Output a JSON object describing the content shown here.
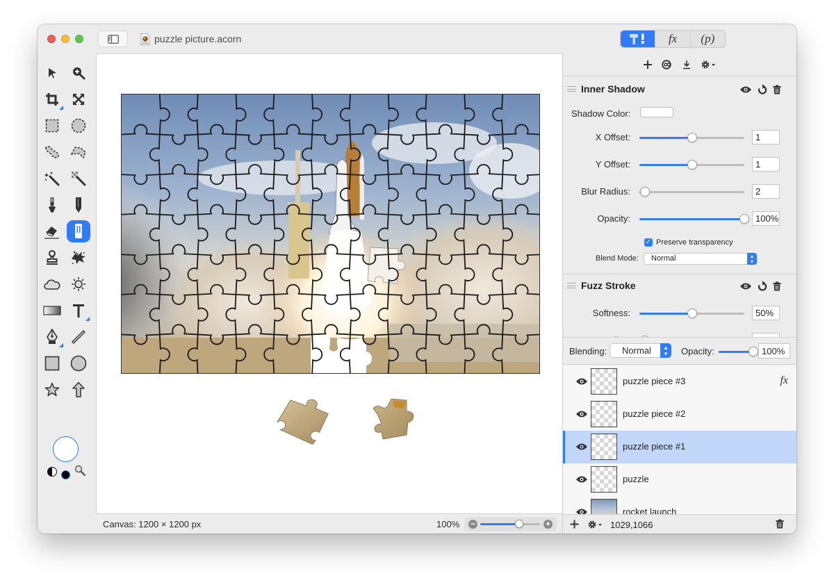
{
  "window": {
    "title": "puzzle picture.acorn",
    "traffic_lights": [
      "close",
      "minimize",
      "zoom"
    ]
  },
  "inspector_tabs": [
    {
      "name": "tools",
      "label": "",
      "icon": "hammer-brush-icon",
      "active": true
    },
    {
      "name": "filters",
      "label": "fx",
      "active": false
    },
    {
      "name": "properties",
      "label": "(p)",
      "active": false
    }
  ],
  "tools": [
    {
      "name": "select-arrow",
      "icon": "arrow-icon"
    },
    {
      "name": "zoom",
      "icon": "magnify-plus-icon"
    },
    {
      "name": "crop",
      "icon": "crop-icon"
    },
    {
      "name": "transform",
      "icon": "expand-arrows-icon"
    },
    {
      "name": "rect-select",
      "icon": "dashed-square-icon"
    },
    {
      "name": "ellipse-select",
      "icon": "dashed-circle-icon"
    },
    {
      "name": "lasso",
      "icon": "lasso-icon"
    },
    {
      "name": "polygon-lasso",
      "icon": "polygon-lasso-icon"
    },
    {
      "name": "magic-wand",
      "icon": "magic-wand-icon"
    },
    {
      "name": "instant-alpha",
      "icon": "instant-alpha-icon"
    },
    {
      "name": "brush",
      "icon": "brush-icon"
    },
    {
      "name": "pencil",
      "icon": "pencil-icon"
    },
    {
      "name": "eraser",
      "icon": "eraser-icon"
    },
    {
      "name": "clone",
      "icon": "clone-tool-icon",
      "active": true
    },
    {
      "name": "stamp",
      "icon": "stamp-icon"
    },
    {
      "name": "paint-splatter",
      "icon": "splatter-icon"
    },
    {
      "name": "burn",
      "icon": "cloud-icon"
    },
    {
      "name": "dodge",
      "icon": "sun-icon"
    },
    {
      "name": "gradient",
      "icon": "gradient-icon"
    },
    {
      "name": "text",
      "icon": "text-icon"
    },
    {
      "name": "bezier-pen",
      "icon": "pen-nib-icon"
    },
    {
      "name": "line",
      "icon": "line-icon"
    },
    {
      "name": "rectangle",
      "icon": "rectangle-icon"
    },
    {
      "name": "oval",
      "icon": "oval-icon"
    },
    {
      "name": "star",
      "icon": "star-icon"
    },
    {
      "name": "arrow",
      "icon": "arrow-up-icon"
    }
  ],
  "colors": {
    "accent": "#2f7cf6",
    "selected_row": "#c3d7fb",
    "fill_color": "#ffffff",
    "stroke_color": "#000000"
  },
  "filters_toolbar": [
    "plus-icon",
    "filter-preset-icon",
    "download-icon",
    "gear-dropdown-icon"
  ],
  "filters": [
    {
      "title": "Inner Shadow",
      "shadow_color_label": "Shadow Color:",
      "shadow_color": "#ffffff",
      "params": [
        {
          "label": "X Offset:",
          "value": "1",
          "fraction": 0.5
        },
        {
          "label": "Y Offset:",
          "value": "1",
          "fraction": 0.5
        },
        {
          "label": "Blur Radius:",
          "value": "2",
          "fraction": 0.05
        },
        {
          "label": "Opacity:",
          "value": "100%",
          "fraction": 1.0
        }
      ],
      "preserve_transparency_label": "Preserve transparency",
      "preserve_transparency": true,
      "blend_mode_label": "Blend Mode:",
      "blend_mode": "Normal"
    },
    {
      "title": "Fuzz Stroke",
      "params": [
        {
          "label": "Softness:",
          "value": "50%",
          "fraction": 0.5
        },
        {
          "label": "Radius:",
          "value": "",
          "fraction": 0.05
        }
      ]
    }
  ],
  "layer_blending": {
    "blending_label": "Blending:",
    "blending_value": "Normal",
    "opacity_label": "Opacity:",
    "opacity_value": "100%",
    "opacity_fraction": 1.0
  },
  "layers": [
    {
      "name": "puzzle piece #3",
      "visible": true,
      "has_fx": true,
      "fx_label": "fx",
      "selected": false,
      "thumb": "transparent"
    },
    {
      "name": "puzzle piece #2",
      "visible": true,
      "has_fx": false,
      "selected": false,
      "thumb": "transparent"
    },
    {
      "name": "puzzle piece #1",
      "visible": true,
      "has_fx": false,
      "selected": true,
      "thumb": "transparent"
    },
    {
      "name": "puzzle",
      "visible": true,
      "has_fx": false,
      "selected": false,
      "thumb": "transparent"
    },
    {
      "name": "rocket launch",
      "visible": true,
      "has_fx": false,
      "selected": false,
      "thumb": "photo"
    }
  ],
  "layers_footer": {
    "coords": "1029,1066"
  },
  "status": {
    "canvas_size": "Canvas: 1200 × 1200 px",
    "zoom": "100%",
    "zoom_fraction": 0.65
  },
  "canvas": {
    "puzzle_columns": 11,
    "puzzle_rows": 7
  }
}
